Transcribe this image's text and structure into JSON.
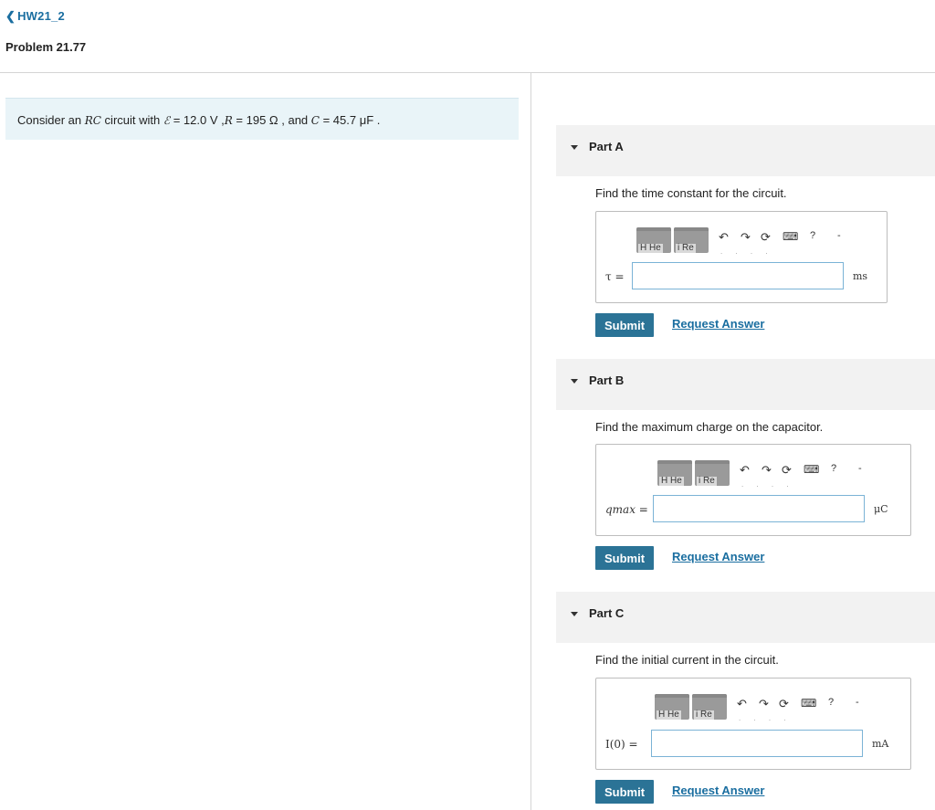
{
  "nav": {
    "back_label": "HW21_2",
    "problem_title": "Problem 21.77"
  },
  "problem": {
    "pre": "Consider an ",
    "rc": "RC",
    "mid1": " circuit with ",
    "emf": "ℰ",
    "emf_val": " = 12.0 V ",
    "r_sep": ",",
    "r": "R",
    "r_val": " = 195 Ω ",
    "and": ", and ",
    "c": "C",
    "c_val": " = 45.7 μF",
    "end": " ."
  },
  "toolbar": {
    "block1_caption": "H  He",
    "block2_caption": "i  Re",
    "undo_icon": "↶",
    "redo_icon": "↷",
    "reset_icon": "⟳",
    "keyboard_icon": "⌨",
    "help_icon": "?",
    "more_icon": "-"
  },
  "parts": [
    {
      "label": "Part A",
      "question": "Find the time constant for the circuit.",
      "var_label": "τ =",
      "unit": "ms",
      "input_value": "",
      "submit": "Submit",
      "request": "Request Answer"
    },
    {
      "label": "Part B",
      "question": "Find the maximum charge on the capacitor.",
      "var_label": "qmax =",
      "unit": "μC",
      "input_value": "",
      "submit": "Submit",
      "request": "Request Answer"
    },
    {
      "label": "Part C",
      "question": "Find the initial current in the circuit.",
      "var_label": "I(0) =",
      "unit": "mA",
      "input_value": "",
      "submit": "Submit",
      "request": "Request Answer"
    }
  ],
  "colors": {
    "accent": "#1a6ea0",
    "button": "#2b7396",
    "problem_bg": "#e9f4f8",
    "header_bg": "#f2f2f2"
  }
}
